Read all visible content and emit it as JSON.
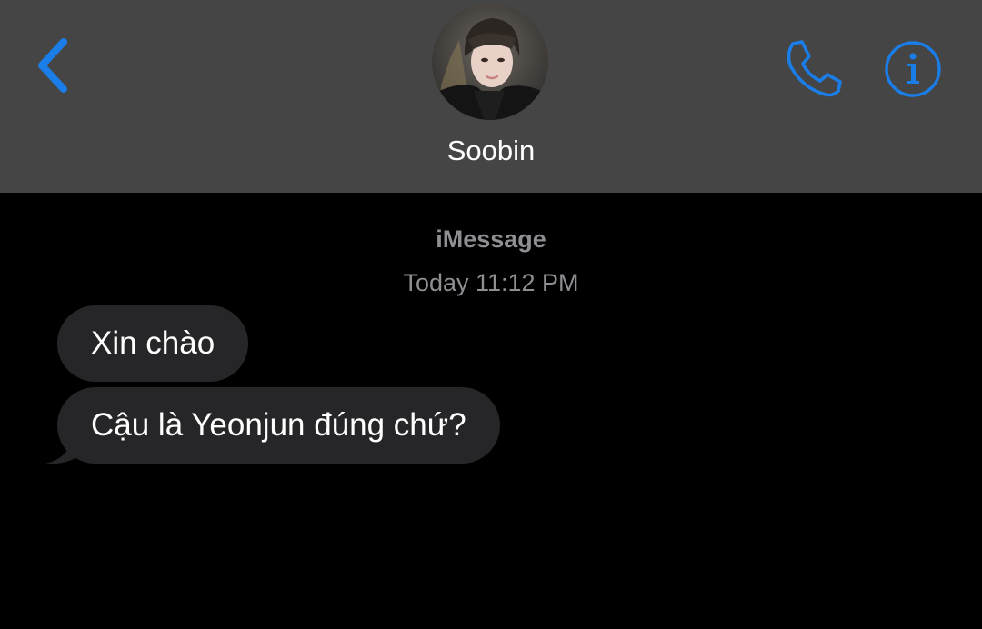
{
  "header": {
    "contact_name": "Soobin",
    "back_icon": "chevron-left-icon",
    "call_icon": "phone-icon",
    "info_icon": "info-icon",
    "accent_color": "#1a7de8",
    "background_color": "#454545"
  },
  "conversation": {
    "service_label": "iMessage",
    "timestamp": "Today 11:12 PM",
    "messages": [
      {
        "sender": "Soobin",
        "text": "Xin chào"
      },
      {
        "sender": "Soobin",
        "text": "Cậu là Yeonjun đúng chứ?"
      }
    ],
    "bubble_color": "#262628"
  }
}
